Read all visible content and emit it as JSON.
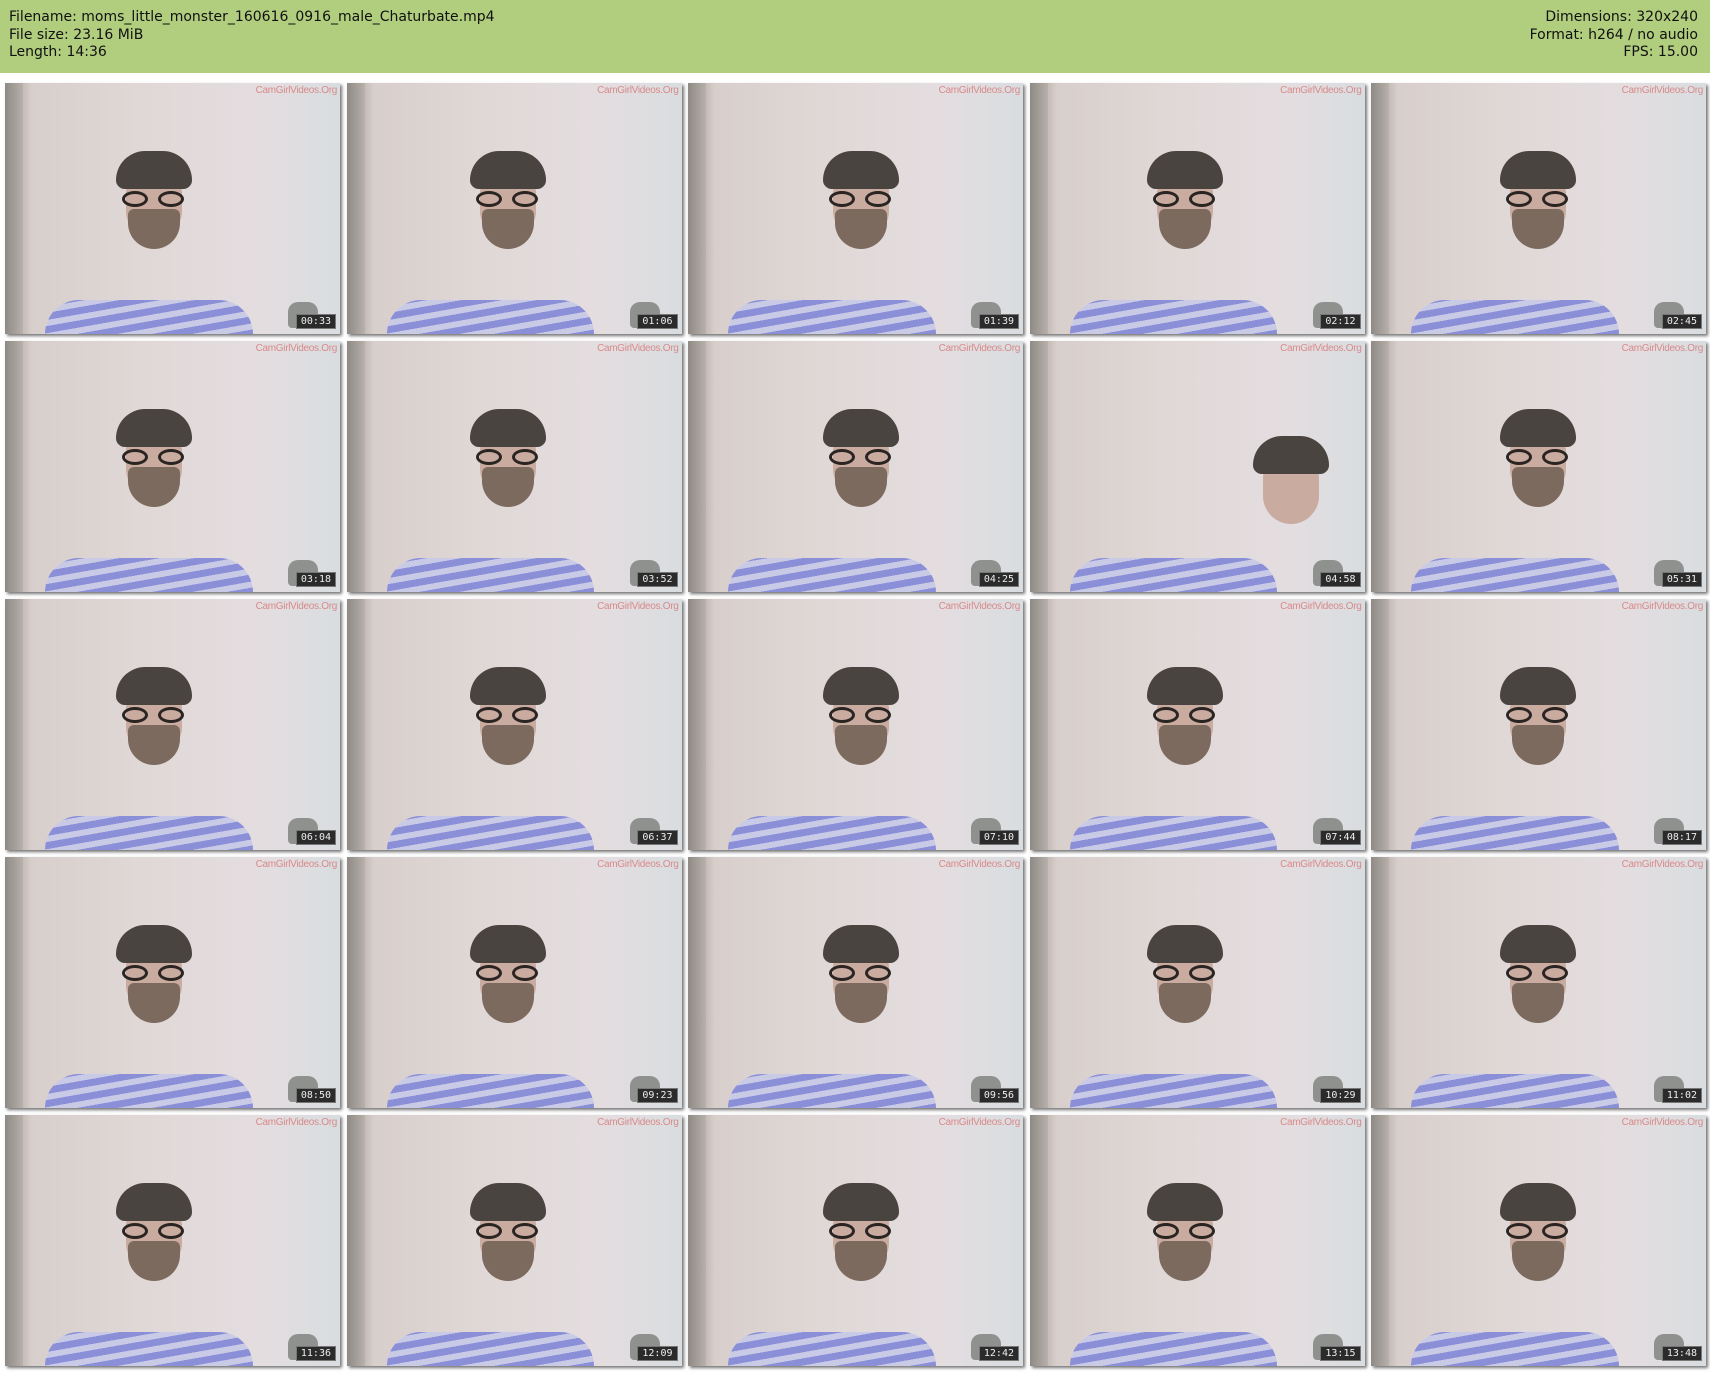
{
  "header": {
    "filename": "Filename: moms_little_monster_160616_0916_male_Chaturbate.mp4",
    "filesize": "File size: 23.16 MiB",
    "length": "Length: 14:36",
    "dimensions": "Dimensions: 320x240",
    "format": "Format: h264 / no audio",
    "fps": "FPS: 15.00"
  },
  "watermark": "CamGirlVideos.Org",
  "thumbnails": [
    {
      "time": "00:33"
    },
    {
      "time": "01:06"
    },
    {
      "time": "01:39"
    },
    {
      "time": "02:12"
    },
    {
      "time": "02:45"
    },
    {
      "time": "03:18"
    },
    {
      "time": "03:52"
    },
    {
      "time": "04:25"
    },
    {
      "time": "04:58"
    },
    {
      "time": "05:31"
    },
    {
      "time": "06:04"
    },
    {
      "time": "06:37"
    },
    {
      "time": "07:10"
    },
    {
      "time": "07:44"
    },
    {
      "time": "08:17"
    },
    {
      "time": "08:50"
    },
    {
      "time": "09:23"
    },
    {
      "time": "09:56"
    },
    {
      "time": "10:29"
    },
    {
      "time": "11:02"
    },
    {
      "time": "11:36"
    },
    {
      "time": "12:09"
    },
    {
      "time": "12:42"
    },
    {
      "time": "13:15"
    },
    {
      "time": "13:48"
    }
  ]
}
